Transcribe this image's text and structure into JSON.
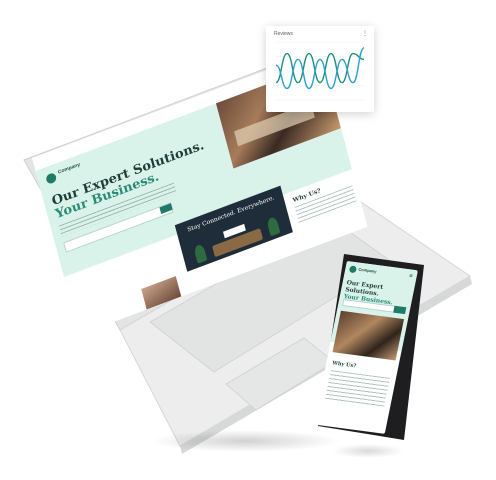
{
  "hero": {
    "brand": "Company",
    "title_line1": "Our Expert Solutions.",
    "title_line2": "Your Business."
  },
  "banner": {
    "title": "Stay Connected. Everywhere."
  },
  "why": {
    "title": "Why Us?"
  },
  "review_card": {
    "title": "Reviews",
    "menu_icon": "more-vertical-icon"
  },
  "chart_data": {
    "type": "line",
    "title": "Reviews",
    "x": [
      0,
      1,
      2,
      3,
      4,
      5,
      6,
      7,
      8
    ],
    "ylim": [
      0,
      10
    ],
    "series": [
      {
        "color": "#1f8f7a",
        "values": [
          3,
          8,
          3,
          8,
          3,
          8,
          3,
          8,
          7
        ]
      },
      {
        "color": "#2a9fd0",
        "values": [
          6,
          2,
          7,
          2,
          7,
          2,
          7,
          3,
          9
        ]
      }
    ],
    "grid": true
  },
  "phone": {
    "brand": "Company",
    "title_line1": "Our Expert Solutions.",
    "title_line2": "Your Business.",
    "why_title": "Why Us?"
  },
  "colors": {
    "accent": "#1f7a68",
    "hero_bg": "#d9f2ea",
    "device": "#e6e6e6"
  }
}
